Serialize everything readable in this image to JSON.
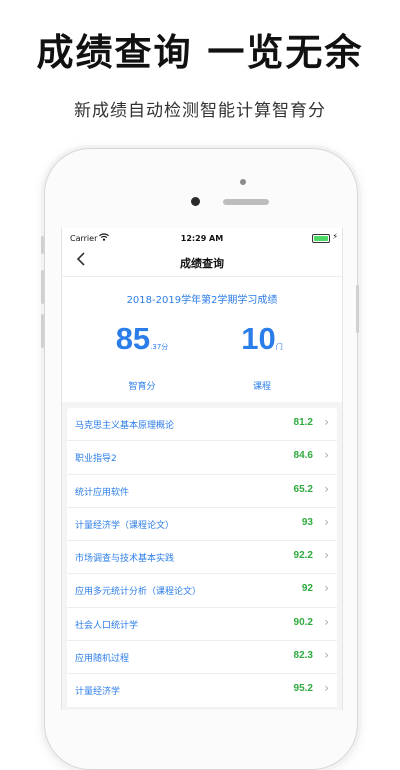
{
  "promo": {
    "title": "成绩查询 一览无余",
    "subtitle": "新成绩自动检测智能计算智育分"
  },
  "status_bar": {
    "carrier": "Carrier",
    "wifi_icon": "wifi-icon",
    "time": "12:29 AM",
    "battery_color": "#4cd964"
  },
  "nav": {
    "back_icon": "chevron-left-icon",
    "title": "成绩查询"
  },
  "summary": {
    "term": "2018-2019学年第2学期学习成绩",
    "gpa_value": "85",
    "gpa_unit": ".37分",
    "gpa_label": "智育分",
    "course_count": "10",
    "course_unit": "门",
    "course_label": "课程"
  },
  "courses": [
    {
      "name": "马克思主义基本原理概论",
      "score": "81.2"
    },
    {
      "name": "职业指导2",
      "score": "84.6"
    },
    {
      "name": "统计应用软件",
      "score": "65.2"
    },
    {
      "name": "计量经济学（课程论文）",
      "score": "93"
    },
    {
      "name": "市场调查与技术基本实践",
      "score": "92.2"
    },
    {
      "name": "应用多元统计分析（课程论文）",
      "score": "92"
    },
    {
      "name": "社会人口统计学",
      "score": "90.2"
    },
    {
      "name": "应用随机过程",
      "score": "82.3"
    },
    {
      "name": "计量经济学",
      "score": "95.2"
    }
  ],
  "colors": {
    "accent": "#2b7de9",
    "score": "#2eaa3e"
  }
}
